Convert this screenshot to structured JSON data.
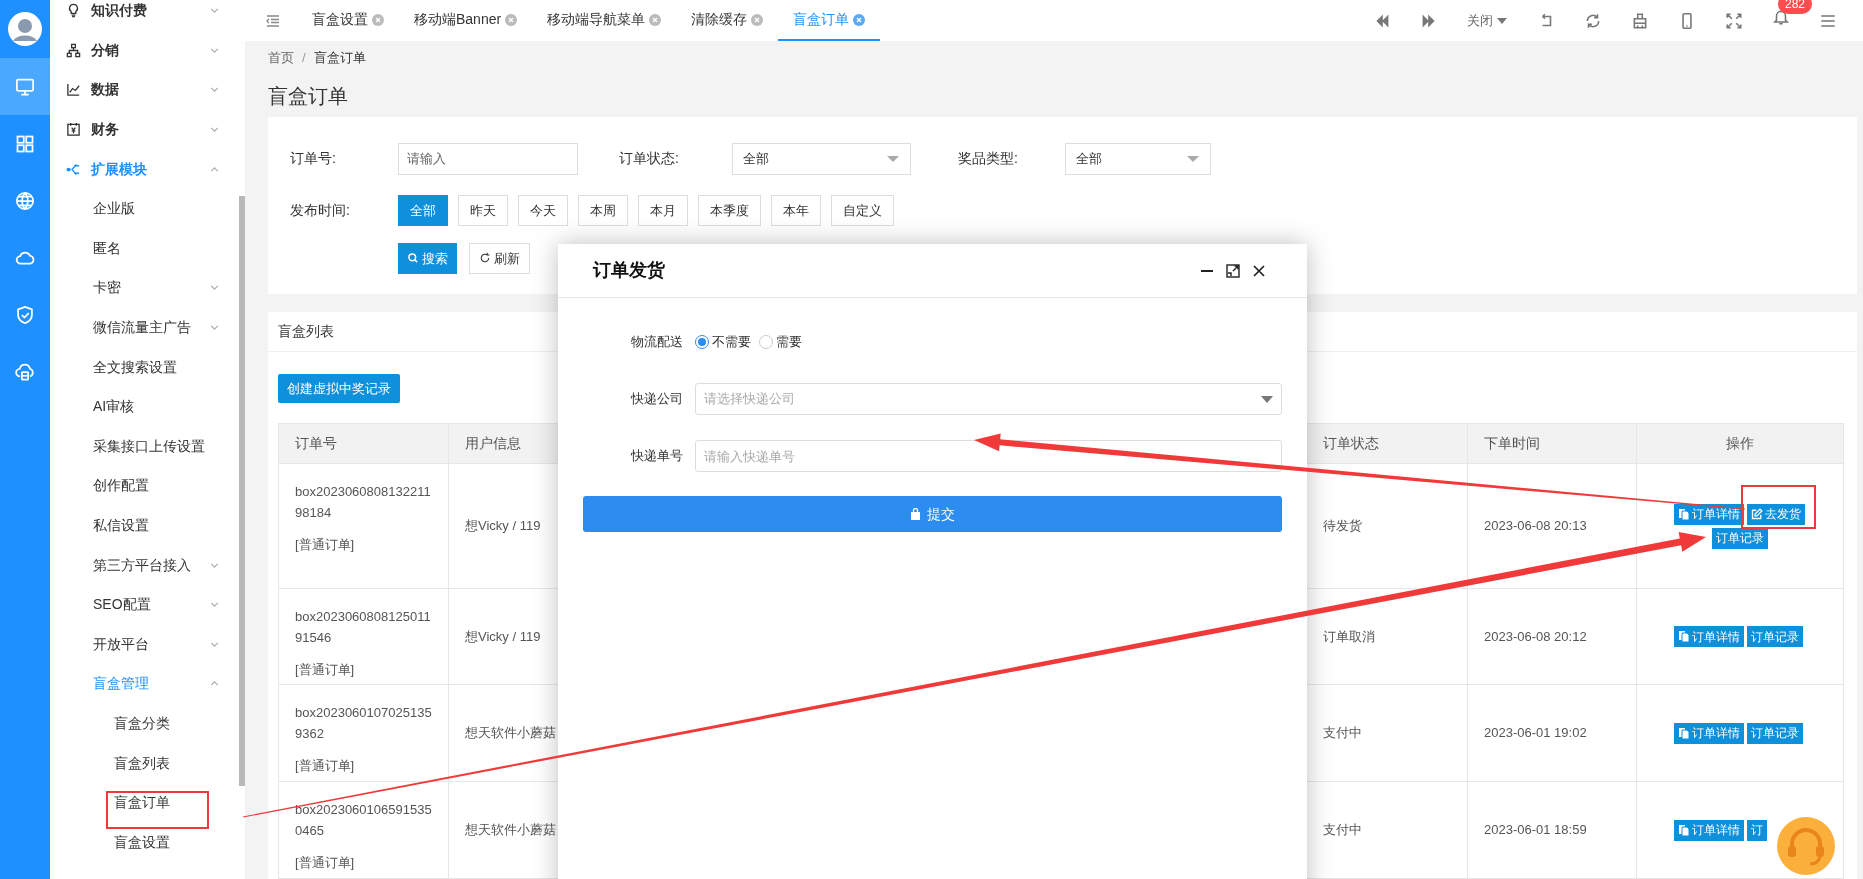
{
  "rail": [
    {
      "selected": true
    },
    {
      "selected": false
    },
    {
      "selected": false
    },
    {
      "selected": false
    },
    {
      "selected": false
    },
    {
      "selected": false
    }
  ],
  "sidebar": {
    "items": [
      {
        "label": "知识付费",
        "expanded": false
      },
      {
        "label": "分销",
        "expanded": false
      },
      {
        "label": "数据",
        "expanded": false
      },
      {
        "label": "财务",
        "expanded": false
      },
      {
        "label": "扩展模块",
        "expanded": true,
        "children": [
          {
            "label": "企业版"
          },
          {
            "label": "匿名"
          },
          {
            "label": "卡密",
            "expanded": false
          },
          {
            "label": "微信流量主广告",
            "expanded": false
          },
          {
            "label": "全文搜索设置"
          },
          {
            "label": "AI审核"
          },
          {
            "label": "采集接口上传设置"
          },
          {
            "label": "创作配置"
          },
          {
            "label": "私信设置"
          },
          {
            "label": "第三方平台接入",
            "expanded": false
          },
          {
            "label": "SEO配置",
            "expanded": false
          },
          {
            "label": "开放平台",
            "expanded": false
          },
          {
            "label": "盲盒管理",
            "expanded": true,
            "children": [
              {
                "label": "盲盒分类"
              },
              {
                "label": "盲盒列表"
              },
              {
                "label": "盲盒订单"
              },
              {
                "label": "盲盒设置"
              }
            ]
          }
        ]
      }
    ]
  },
  "tabs": [
    {
      "label": "盲盒设置",
      "selected": false
    },
    {
      "label": "移动端Banner",
      "selected": false
    },
    {
      "label": "移动端导航菜单",
      "selected": false
    },
    {
      "label": "清除缓存",
      "selected": false
    },
    {
      "label": "盲盒订单",
      "selected": true
    }
  ],
  "toolbar": {
    "close_menu": "关闭",
    "notification_count": "282"
  },
  "breadcrumb": {
    "items": [
      "首页",
      "盲盒订单"
    ],
    "separator": "/"
  },
  "page_title": "盲盒订单",
  "filters": {
    "order_no": {
      "label": "订单号:",
      "placeholder": "请输入"
    },
    "order_status": {
      "label": "订单状态:",
      "value": "全部"
    },
    "prize_type": {
      "label": "奖品类型:",
      "value": "全部"
    },
    "publish_time": {
      "label": "发布时间:",
      "options": [
        {
          "label": "全部",
          "selected": true
        },
        {
          "label": "昨天",
          "selected": false
        },
        {
          "label": "今天",
          "selected": false
        },
        {
          "label": "本周",
          "selected": false
        },
        {
          "label": "本月",
          "selected": false
        },
        {
          "label": "本季度",
          "selected": false
        },
        {
          "label": "本年",
          "selected": false
        },
        {
          "label": "自定义",
          "selected": false
        }
      ]
    },
    "search_button": "搜索",
    "refresh_button": "刷新"
  },
  "list": {
    "title": "盲盒列表",
    "create_button": "创建虚拟中奖记录",
    "table": {
      "columns": [
        "订单号",
        "用户信息",
        "订单状态",
        "下单时间",
        "操作"
      ],
      "rows": [
        {
          "order_no": "box202306080813221198184",
          "order_type": "[普通订单]",
          "user": "想Vicky / 119",
          "status": "待发货",
          "time": "2023-06-08 20:13",
          "actions": [
            {
              "kind": "detail",
              "label": "订单详情"
            },
            {
              "kind": "ship",
              "label": "去发货"
            },
            {
              "kind": "log",
              "label": "订单记录"
            }
          ]
        },
        {
          "order_no": "box202306080812501191546",
          "order_type": "[普通订单]",
          "user": "想Vicky / 119",
          "status": "订单取消",
          "time": "2023-06-08 20:12",
          "actions": [
            {
              "kind": "detail",
              "label": "订单详情"
            },
            {
              "kind": "log",
              "label": "订单记录"
            }
          ]
        },
        {
          "order_no": "box20230601070251359362",
          "order_type": "[普通订单]",
          "user": "想天软件小蘑菇",
          "status": "支付中",
          "time": "2023-06-01 19:02",
          "actions": [
            {
              "kind": "detail",
              "label": "订单详情"
            },
            {
              "kind": "log",
              "label": "订单记录"
            }
          ]
        },
        {
          "order_no": "box20230601065915350465",
          "order_type": "[普通订单]",
          "user": "想天软件小蘑菇",
          "status": "支付中",
          "time": "2023-06-01 18:59",
          "actions": [
            {
              "kind": "detail",
              "label": "订单详情"
            },
            {
              "kind": "log",
              "label": "订"
            }
          ]
        }
      ]
    }
  },
  "dialog": {
    "title": "订单发货",
    "fields": [
      {
        "kind": "radio",
        "label": "物流配送",
        "options": [
          {
            "label": "不需要",
            "selected": true
          },
          {
            "label": "需要",
            "selected": false
          }
        ]
      },
      {
        "kind": "select",
        "label": "快递公司",
        "placeholder": "请选择快递公司"
      },
      {
        "kind": "input",
        "label": "快递单号",
        "placeholder": "请输入快递单号"
      }
    ],
    "submit_button": "提交"
  }
}
